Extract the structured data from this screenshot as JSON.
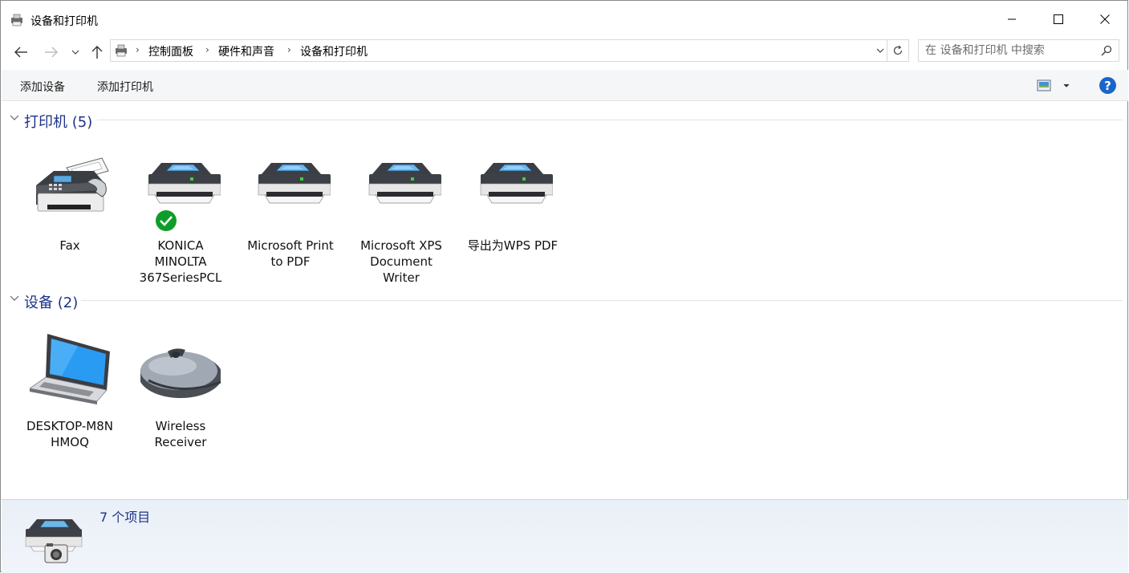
{
  "window": {
    "title": "设备和打印机"
  },
  "address_bar": {
    "breadcrumbs": [
      "控制面板",
      "硬件和声音",
      "设备和打印机"
    ]
  },
  "search": {
    "placeholder": "在 设备和打印机 中搜索"
  },
  "toolbar": {
    "add_device_label": "添加设备",
    "add_printer_label": "添加打印机",
    "help_label": "?"
  },
  "groups": {
    "printers": {
      "title": "打印机 (5)",
      "items": [
        {
          "label": "Fax",
          "icon": "fax-icon"
        },
        {
          "label": "KONICA\nMINOLTA\n367SeriesPCL",
          "icon": "printer-icon",
          "default": true
        },
        {
          "label": "Microsoft Print\nto PDF",
          "icon": "printer-icon"
        },
        {
          "label": "Microsoft XPS\nDocument\nWriter",
          "icon": "printer-icon"
        },
        {
          "label": "导出为WPS PDF",
          "icon": "printer-icon"
        }
      ]
    },
    "devices": {
      "title": "设备 (2)",
      "items": [
        {
          "label": "DESKTOP-M8N\nHMOQ",
          "icon": "laptop-icon"
        },
        {
          "label": "Wireless\nReceiver",
          "icon": "mouse-icon"
        }
      ]
    }
  },
  "details": {
    "count_label": "7 个项目"
  },
  "colors": {
    "group_title": "#1e3287",
    "default_check": "#0f9d2a",
    "help_blue": "#1a66c8",
    "details_bg": "#eaf0f8"
  }
}
